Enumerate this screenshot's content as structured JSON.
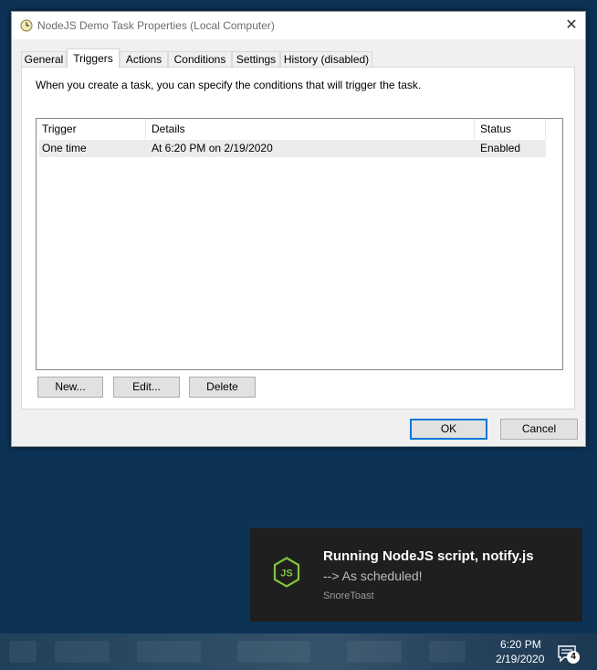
{
  "dialog": {
    "title": "NodeJS Demo Task Properties (Local Computer)",
    "close_glyph": "✕",
    "tabs": [
      {
        "label": "General",
        "active": false
      },
      {
        "label": "Triggers",
        "active": true
      },
      {
        "label": "Actions",
        "active": false
      },
      {
        "label": "Conditions",
        "active": false
      },
      {
        "label": "Settings",
        "active": false
      },
      {
        "label": "History (disabled)",
        "active": false
      }
    ],
    "description": "When you create a task, you can specify the conditions that will trigger the task.",
    "triggers_table": {
      "columns": [
        "Trigger",
        "Details",
        "Status"
      ],
      "rows": [
        {
          "trigger": "One time",
          "details": "At 6:20 PM on 2/19/2020",
          "status": "Enabled"
        }
      ]
    },
    "buttons": {
      "new": "New...",
      "edit": "Edit...",
      "delete": "Delete",
      "ok": "OK",
      "cancel": "Cancel"
    }
  },
  "toast": {
    "icon": "nodejs-icon",
    "title": "Running NodeJS script, notify.js",
    "message": "--> As scheduled!",
    "app_name": "SnoreToast"
  },
  "taskbar": {
    "time": "6:20 PM",
    "date": "2/19/2020",
    "notification_count": "4"
  },
  "colors": {
    "desktop": "#0c3356",
    "accent": "#0078d7",
    "nodejs_green": "#7fc63b"
  }
}
